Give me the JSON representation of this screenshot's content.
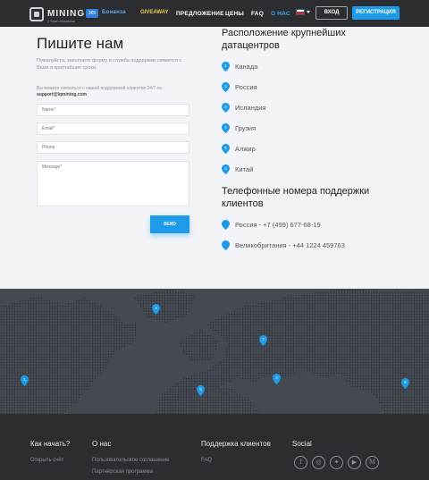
{
  "header": {
    "logo_text": "MINING",
    "logo_subtext": "3 Years of Business",
    "logo_badge": "365",
    "partner1": "Бонанза",
    "partner2": "GIVEAWAY",
    "nav": [
      "ПРЕДЛОЖЕНИЕ",
      "ЦЕНЫ",
      "FAQ",
      "О НАС"
    ],
    "login": "ВХОД",
    "register": "РЕГИСТРАЦИЯ",
    "colors": {
      "accent": "#1e9be8",
      "bg": "#2b2d31"
    }
  },
  "contact": {
    "title": "Пишите нам",
    "lead": "Пожалуйста, заполните форму и служба поддержки свяжется с Вами в кратчайшие сроки.",
    "note": "Вы можете связаться с нашей поддержкой клиентов 24/7 по",
    "email": "support@lqmining.com",
    "placeholders": {
      "name": "Name*",
      "email": "Email*",
      "phone": "Phone",
      "message": "Message*"
    },
    "send": "SEND"
  },
  "locations": {
    "title": "Расположение крупнейших датацентров",
    "items": [
      {
        "num": "1",
        "name": "Канада"
      },
      {
        "num": "2",
        "name": "Россия"
      },
      {
        "num": "3",
        "name": "Исландия"
      },
      {
        "num": "4",
        "name": "Грузия"
      },
      {
        "num": "5",
        "name": "Алжир"
      },
      {
        "num": "6",
        "name": "Китай"
      }
    ]
  },
  "phones": {
    "title": "Телефонные номера поддержки клиентов",
    "items": [
      {
        "text": "Россия - +7 (499) 677-68-19"
      },
      {
        "text": "Великобритания - +44 1224 459763"
      }
    ]
  },
  "map_pins": [
    "1",
    "2",
    "3",
    "4",
    "5",
    "6"
  ],
  "footer": {
    "col1": {
      "title": "Как начать?",
      "links": [
        "Открыть счёт"
      ]
    },
    "col2": {
      "title": "О нас",
      "links": [
        "Пользовательское соглашение",
        "Партнёрская программа"
      ]
    },
    "col3": {
      "title": "Поддержка клиентов",
      "links": [
        "FAQ"
      ]
    },
    "col4": {
      "title": "Social",
      "icons": [
        "facebook-icon",
        "instagram-icon",
        "twitter-icon",
        "youtube-icon",
        "medium-icon"
      ]
    }
  }
}
